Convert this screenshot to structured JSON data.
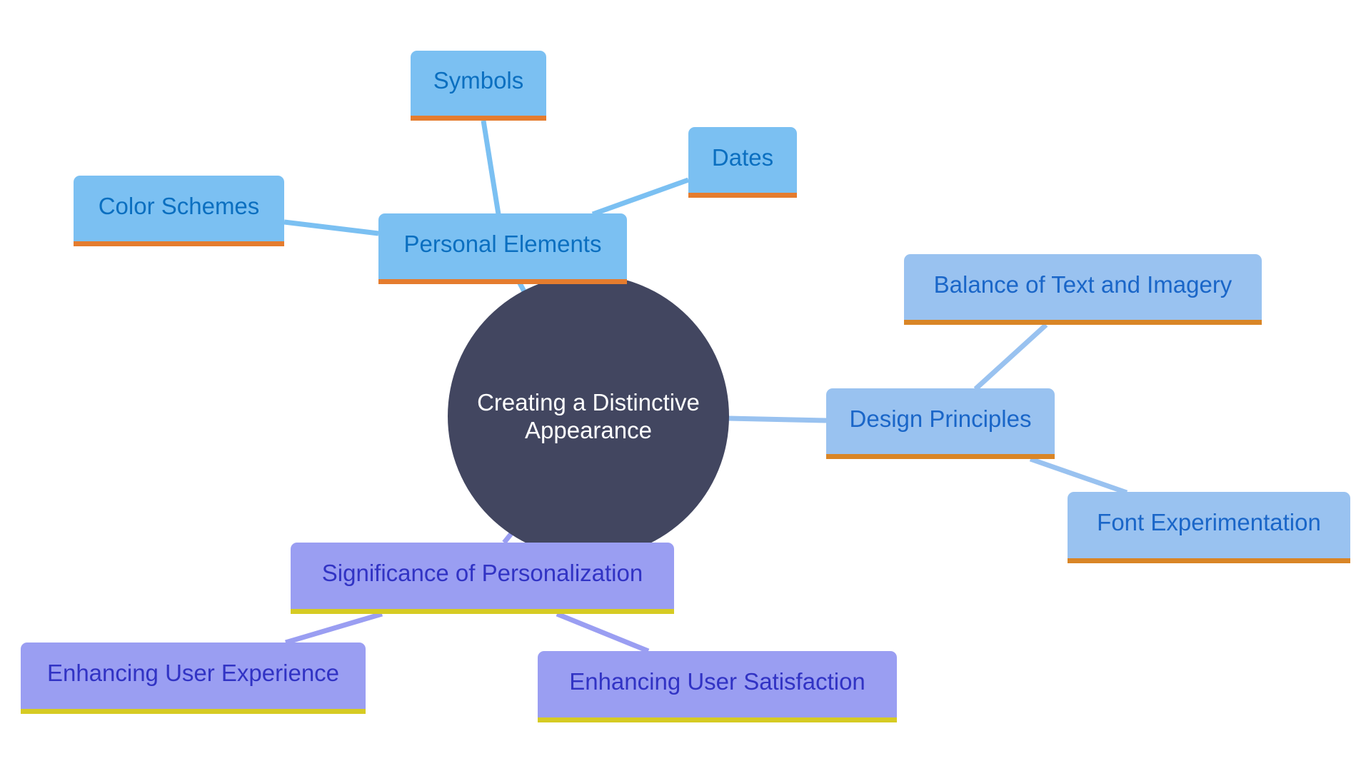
{
  "diagram": {
    "type": "mind-map",
    "center": {
      "line1": "Creating a Distinctive",
      "line2": "Appearance",
      "color": "#424660"
    },
    "branches": [
      {
        "id": "personal",
        "label": "Personal Elements",
        "colors": {
          "fill": "#7BC0F2",
          "text": "#0B6FC0",
          "underline": "#E57C2E",
          "edge": "#7BC0F2"
        },
        "children": [
          "Symbols",
          "Dates",
          "Color Schemes"
        ]
      },
      {
        "id": "design",
        "label": "Design Principles",
        "colors": {
          "fill": "#99C2F0",
          "text": "#1A66C8",
          "underline": "#D98526",
          "edge": "#99C2F0"
        },
        "children": [
          "Balance of Text and Imagery",
          "Font Experimentation"
        ]
      },
      {
        "id": "significance",
        "label": "Significance of Personalization",
        "colors": {
          "fill": "#9A9EF2",
          "text": "#3133C4",
          "underline": "#D6CB23",
          "edge": "#9A9EF2"
        },
        "children": [
          "Enhancing User Experience",
          "Enhancing User Satisfaction"
        ]
      }
    ]
  }
}
